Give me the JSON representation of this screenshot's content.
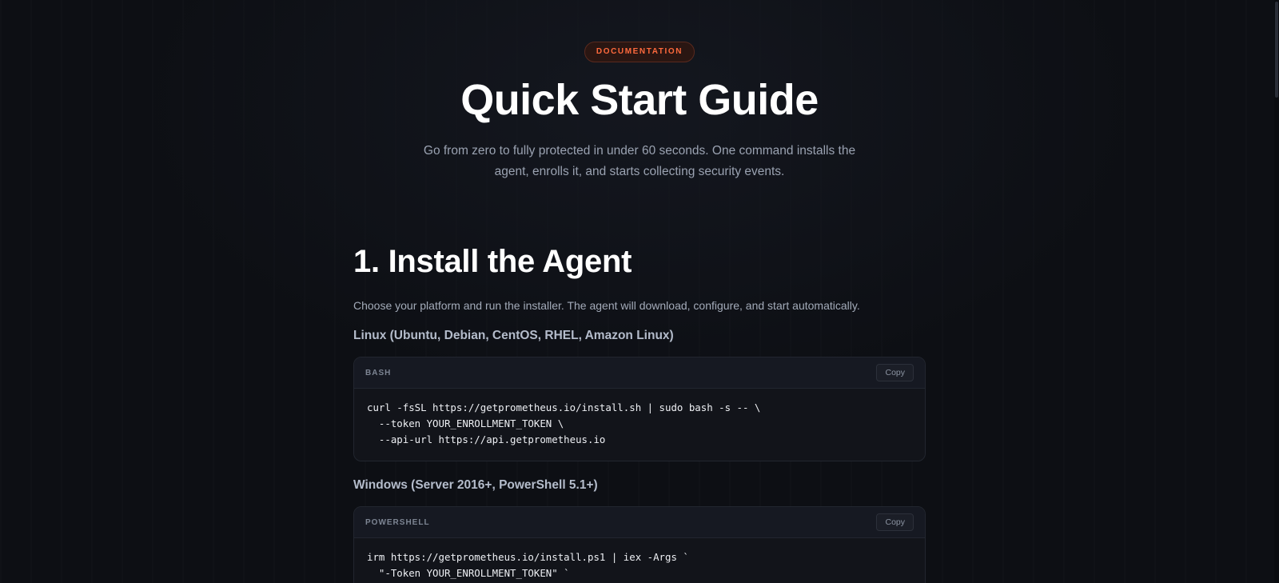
{
  "hero": {
    "badge": "DOCUMENTATION",
    "title": "Quick Start Guide",
    "subtitle": "Go from zero to fully protected in under 60 seconds. One command installs the agent, enrolls it, and starts collecting security events."
  },
  "section": {
    "heading": "1. Install the Agent",
    "lead": "Choose your platform and run the installer. The agent will download, configure, and start automatically."
  },
  "linux": {
    "heading": "Linux (Ubuntu, Debian, CentOS, RHEL, Amazon Linux)",
    "code": {
      "lang": "BASH",
      "copy_label": "Copy",
      "lines": [
        "curl -fsSL https://getprometheus.io/install.sh | sudo bash -s -- \\",
        "  --token YOUR_ENROLLMENT_TOKEN \\",
        "  --api-url https://api.getprometheus.io"
      ]
    }
  },
  "windows": {
    "heading": "Windows (Server 2016+, PowerShell 5.1+)",
    "code": {
      "lang": "POWERSHELL",
      "copy_label": "Copy",
      "lines": [
        "irm https://getprometheus.io/install.ps1 | iex -Args `",
        "  \"-Token YOUR_ENROLLMENT_TOKEN\" `"
      ]
    }
  },
  "colors": {
    "background": "#0d0f14",
    "accent": "#ff6a3d",
    "code_background": "#12141a"
  }
}
